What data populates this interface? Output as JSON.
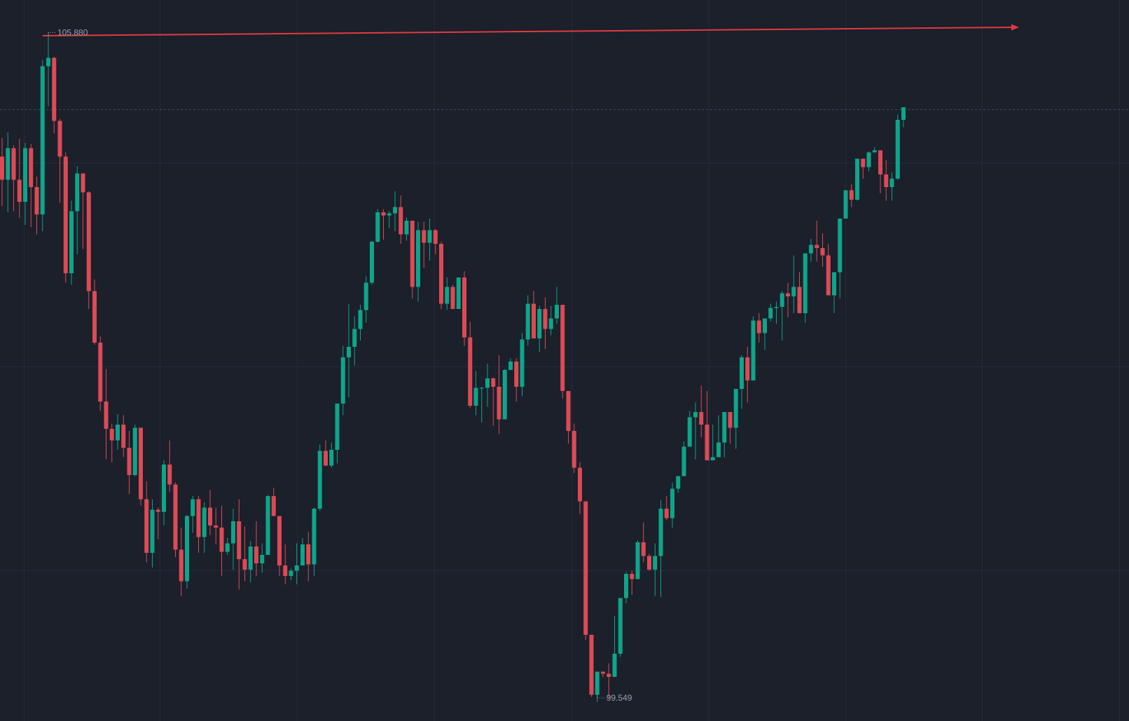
{
  "colors": {
    "background": "#1b202b",
    "up": "#0ea58a",
    "down": "#dc4a55",
    "trend_line": "#e23a3f",
    "grid": "#262d38",
    "label_text": "#9aa1ad"
  },
  "annotations": {
    "high_label": "105.880",
    "low_label": "99.549"
  },
  "chart_data": {
    "type": "candlestick",
    "title": "",
    "xlabel": "",
    "ylabel": "",
    "grid": true,
    "legend": "none",
    "ylim": [
      99.33,
      106.19
    ],
    "last_close": 105.15,
    "high_marker": {
      "bar": 8,
      "value": 105.88
    },
    "low_marker": {
      "bar": 103,
      "value": 99.549
    },
    "trend_line": {
      "start_bar": 7,
      "start_value": 105.85,
      "end_bar": 176,
      "end_value": 105.93,
      "arrow": true,
      "color": "#e23a3f"
    },
    "ohlc": [
      [
        104.7,
        104.88,
        104.23,
        104.48
      ],
      [
        104.48,
        104.93,
        104.17,
        104.78
      ],
      [
        104.78,
        104.81,
        104.18,
        104.48
      ],
      [
        104.48,
        104.87,
        104.12,
        104.27
      ],
      [
        104.27,
        104.83,
        104.05,
        104.78
      ],
      [
        104.78,
        104.82,
        104.03,
        104.41
      ],
      [
        104.41,
        104.51,
        103.96,
        104.15
      ],
      [
        104.15,
        105.62,
        103.99,
        105.56
      ],
      [
        105.56,
        105.88,
        105.18,
        105.64
      ],
      [
        105.64,
        105.65,
        104.92,
        105.04
      ],
      [
        105.04,
        105.06,
        104.26,
        104.7
      ],
      [
        104.7,
        104.74,
        103.5,
        103.59
      ],
      [
        103.59,
        104.28,
        103.48,
        104.18
      ],
      [
        104.18,
        104.61,
        103.77,
        104.54
      ],
      [
        104.54,
        104.54,
        103.82,
        104.36
      ],
      [
        104.36,
        104.37,
        103.25,
        103.42
      ],
      [
        103.42,
        103.53,
        102.91,
        102.93
      ],
      [
        102.93,
        102.99,
        102.28,
        102.37
      ],
      [
        102.37,
        102.68,
        101.82,
        102.11
      ],
      [
        102.11,
        102.16,
        101.79,
        102.0
      ],
      [
        102.0,
        102.25,
        101.91,
        102.15
      ],
      [
        102.15,
        102.24,
        101.84,
        101.93
      ],
      [
        101.93,
        102.09,
        101.49,
        101.67
      ],
      [
        101.67,
        102.15,
        101.66,
        102.12
      ],
      [
        102.12,
        102.12,
        101.38,
        101.44
      ],
      [
        101.44,
        101.61,
        100.84,
        100.93
      ],
      [
        100.93,
        101.44,
        100.79,
        101.34
      ],
      [
        101.34,
        101.36,
        101.06,
        101.32
      ],
      [
        101.32,
        101.81,
        101.19,
        101.77
      ],
      [
        101.77,
        102.0,
        101.51,
        101.58
      ],
      [
        101.58,
        101.6,
        100.89,
        100.96
      ],
      [
        100.96,
        101.17,
        100.52,
        100.66
      ],
      [
        100.66,
        101.29,
        100.59,
        101.28
      ],
      [
        101.28,
        101.47,
        101.12,
        101.44
      ],
      [
        101.44,
        101.47,
        100.93,
        101.08
      ],
      [
        101.08,
        101.41,
        100.93,
        101.36
      ],
      [
        101.36,
        101.53,
        101.1,
        101.19
      ],
      [
        101.19,
        101.36,
        101.01,
        101.17
      ],
      [
        101.17,
        101.38,
        100.71,
        100.94
      ],
      [
        100.94,
        101.07,
        100.91,
        101.02
      ],
      [
        101.02,
        101.35,
        100.77,
        101.23
      ],
      [
        101.23,
        101.44,
        100.58,
        100.87
      ],
      [
        100.87,
        101.18,
        100.66,
        100.77
      ],
      [
        100.77,
        101.04,
        100.65,
        100.99
      ],
      [
        100.99,
        101.23,
        100.71,
        100.83
      ],
      [
        100.83,
        101.02,
        100.74,
        100.91
      ],
      [
        100.91,
        101.48,
        100.91,
        101.47
      ],
      [
        101.47,
        101.55,
        101.29,
        101.28
      ],
      [
        101.28,
        101.28,
        100.71,
        100.81
      ],
      [
        100.81,
        101.01,
        100.63,
        100.71
      ],
      [
        100.71,
        100.78,
        100.67,
        100.76
      ],
      [
        100.76,
        101.02,
        100.63,
        100.81
      ],
      [
        100.81,
        101.07,
        100.85,
        101.01
      ],
      [
        101.01,
        101.13,
        100.66,
        100.82
      ],
      [
        100.82,
        101.36,
        100.71,
        101.35
      ],
      [
        101.35,
        101.96,
        101.33,
        101.9
      ],
      [
        101.9,
        102.0,
        101.76,
        101.76
      ],
      [
        101.76,
        101.98,
        101.74,
        101.91
      ],
      [
        101.91,
        102.24,
        101.78,
        102.35
      ],
      [
        102.35,
        102.9,
        102.24,
        102.79
      ],
      [
        102.79,
        103.3,
        102.41,
        102.89
      ],
      [
        102.89,
        103.18,
        102.71,
        103.06
      ],
      [
        103.06,
        103.29,
        102.95,
        103.24
      ],
      [
        103.24,
        103.56,
        103.12,
        103.5
      ],
      [
        103.5,
        103.9,
        103.48,
        103.89
      ],
      [
        103.89,
        104.2,
        103.88,
        104.17
      ],
      [
        104.17,
        104.2,
        103.91,
        104.14
      ],
      [
        104.14,
        104.18,
        104.02,
        104.16
      ],
      [
        104.16,
        104.37,
        103.99,
        104.22
      ],
      [
        104.22,
        104.33,
        103.87,
        103.96
      ],
      [
        103.96,
        104.12,
        103.9,
        104.09
      ],
      [
        104.09,
        104.09,
        103.35,
        103.46
      ],
      [
        103.46,
        104.08,
        103.32,
        104.0
      ],
      [
        104.0,
        104.08,
        103.64,
        103.88
      ],
      [
        103.88,
        104.11,
        103.71,
        104.0
      ],
      [
        104.0,
        104.01,
        103.77,
        103.87
      ],
      [
        103.87,
        103.89,
        103.25,
        103.3
      ],
      [
        103.3,
        103.55,
        103.24,
        103.46
      ],
      [
        103.46,
        103.48,
        103.25,
        103.25
      ],
      [
        103.25,
        103.52,
        103.39,
        103.55
      ],
      [
        103.55,
        103.61,
        102.9,
        102.98
      ],
      [
        102.98,
        103.13,
        102.31,
        102.33
      ],
      [
        102.33,
        102.66,
        102.24,
        102.5
      ],
      [
        102.5,
        102.51,
        102.17,
        102.5
      ],
      [
        102.5,
        102.73,
        102.32,
        102.59
      ],
      [
        102.59,
        102.6,
        102.14,
        102.51
      ],
      [
        102.51,
        102.81,
        102.06,
        102.2
      ],
      [
        102.2,
        102.68,
        102.26,
        102.67
      ],
      [
        102.67,
        102.78,
        102.73,
        102.75
      ],
      [
        102.75,
        102.78,
        102.37,
        102.51
      ],
      [
        102.51,
        103.02,
        102.42,
        102.96
      ],
      [
        102.96,
        103.38,
        102.9,
        103.3
      ],
      [
        103.3,
        103.42,
        103.24,
        102.97
      ],
      [
        102.97,
        103.28,
        102.84,
        103.25
      ],
      [
        103.25,
        103.36,
        102.87,
        103.06
      ],
      [
        103.06,
        103.28,
        103.0,
        103.16
      ],
      [
        103.16,
        103.46,
        103.11,
        103.29
      ],
      [
        103.29,
        103.26,
        102.4,
        102.47
      ],
      [
        102.47,
        102.47,
        101.97,
        102.09
      ],
      [
        102.09,
        102.16,
        101.69,
        101.74
      ],
      [
        101.74,
        101.79,
        101.3,
        101.42
      ],
      [
        101.42,
        101.41,
        100.1,
        100.15
      ],
      [
        100.15,
        100.13,
        99.56,
        99.58
      ],
      [
        99.58,
        99.76,
        99.51,
        99.8
      ],
      [
        99.8,
        99.79,
        99.75,
        99.78
      ],
      [
        99.78,
        99.88,
        99.55,
        99.75
      ],
      [
        99.75,
        100.33,
        99.76,
        99.97
      ],
      [
        99.97,
        100.43,
        99.94,
        100.5
      ],
      [
        100.5,
        100.75,
        100.45,
        100.73
      ],
      [
        100.73,
        100.76,
        100.53,
        100.68
      ],
      [
        100.68,
        101.05,
        100.71,
        101.03
      ],
      [
        101.03,
        101.22,
        100.84,
        100.9
      ],
      [
        100.9,
        100.92,
        100.76,
        100.77
      ],
      [
        100.77,
        101.02,
        100.52,
        100.9
      ],
      [
        100.9,
        101.43,
        100.51,
        101.35
      ],
      [
        101.35,
        101.47,
        101.24,
        101.26
      ],
      [
        101.26,
        101.6,
        101.17,
        101.54
      ],
      [
        101.54,
        101.65,
        101.5,
        101.66
      ],
      [
        101.66,
        101.99,
        101.71,
        101.94
      ],
      [
        101.94,
        102.28,
        102.07,
        102.22
      ],
      [
        102.22,
        102.36,
        101.82,
        102.27
      ],
      [
        102.27,
        102.52,
        102.03,
        102.15
      ],
      [
        102.15,
        102.47,
        101.85,
        101.81
      ],
      [
        101.81,
        102.15,
        101.85,
        101.84
      ],
      [
        101.84,
        102.24,
        101.84,
        101.98
      ],
      [
        101.98,
        102.26,
        101.84,
        102.27
      ],
      [
        102.27,
        102.26,
        101.97,
        102.12
      ],
      [
        102.12,
        102.46,
        101.92,
        102.49
      ],
      [
        102.49,
        102.81,
        102.3,
        102.79
      ],
      [
        102.79,
        102.89,
        102.36,
        102.57
      ],
      [
        102.57,
        103.18,
        102.61,
        103.14
      ],
      [
        103.14,
        103.21,
        102.93,
        103.02
      ],
      [
        103.02,
        103.14,
        102.86,
        103.16
      ],
      [
        103.16,
        103.3,
        103.13,
        103.26
      ],
      [
        103.26,
        103.32,
        103.11,
        103.27
      ],
      [
        103.27,
        103.42,
        102.95,
        103.4
      ],
      [
        103.4,
        103.5,
        103.17,
        103.37
      ],
      [
        103.37,
        103.76,
        103.21,
        103.46
      ],
      [
        103.46,
        103.6,
        103.26,
        103.21
      ],
      [
        103.21,
        103.62,
        103.12,
        103.78
      ],
      [
        103.78,
        103.92,
        103.7,
        103.86
      ],
      [
        103.86,
        104.09,
        103.7,
        103.83
      ],
      [
        103.83,
        103.97,
        103.65,
        103.76
      ],
      [
        103.76,
        103.87,
        103.38,
        103.38
      ],
      [
        103.38,
        103.52,
        103.21,
        103.6
      ],
      [
        103.6,
        103.88,
        103.35,
        104.11
      ],
      [
        104.11,
        104.37,
        104.24,
        104.38
      ],
      [
        104.38,
        104.44,
        104.22,
        104.29
      ],
      [
        104.29,
        104.44,
        104.28,
        104.68
      ],
      [
        104.68,
        104.65,
        104.49,
        104.6
      ],
      [
        104.6,
        104.75,
        104.56,
        104.74
      ],
      [
        104.74,
        104.79,
        104.75,
        104.76
      ],
      [
        104.76,
        104.76,
        104.35,
        104.53
      ],
      [
        104.53,
        104.67,
        104.28,
        104.41
      ],
      [
        104.41,
        104.55,
        104.28,
        104.49
      ],
      [
        104.49,
        105.1,
        104.48,
        105.05
      ],
      [
        105.05,
        105.12,
        104.98,
        105.17
      ]
    ]
  }
}
